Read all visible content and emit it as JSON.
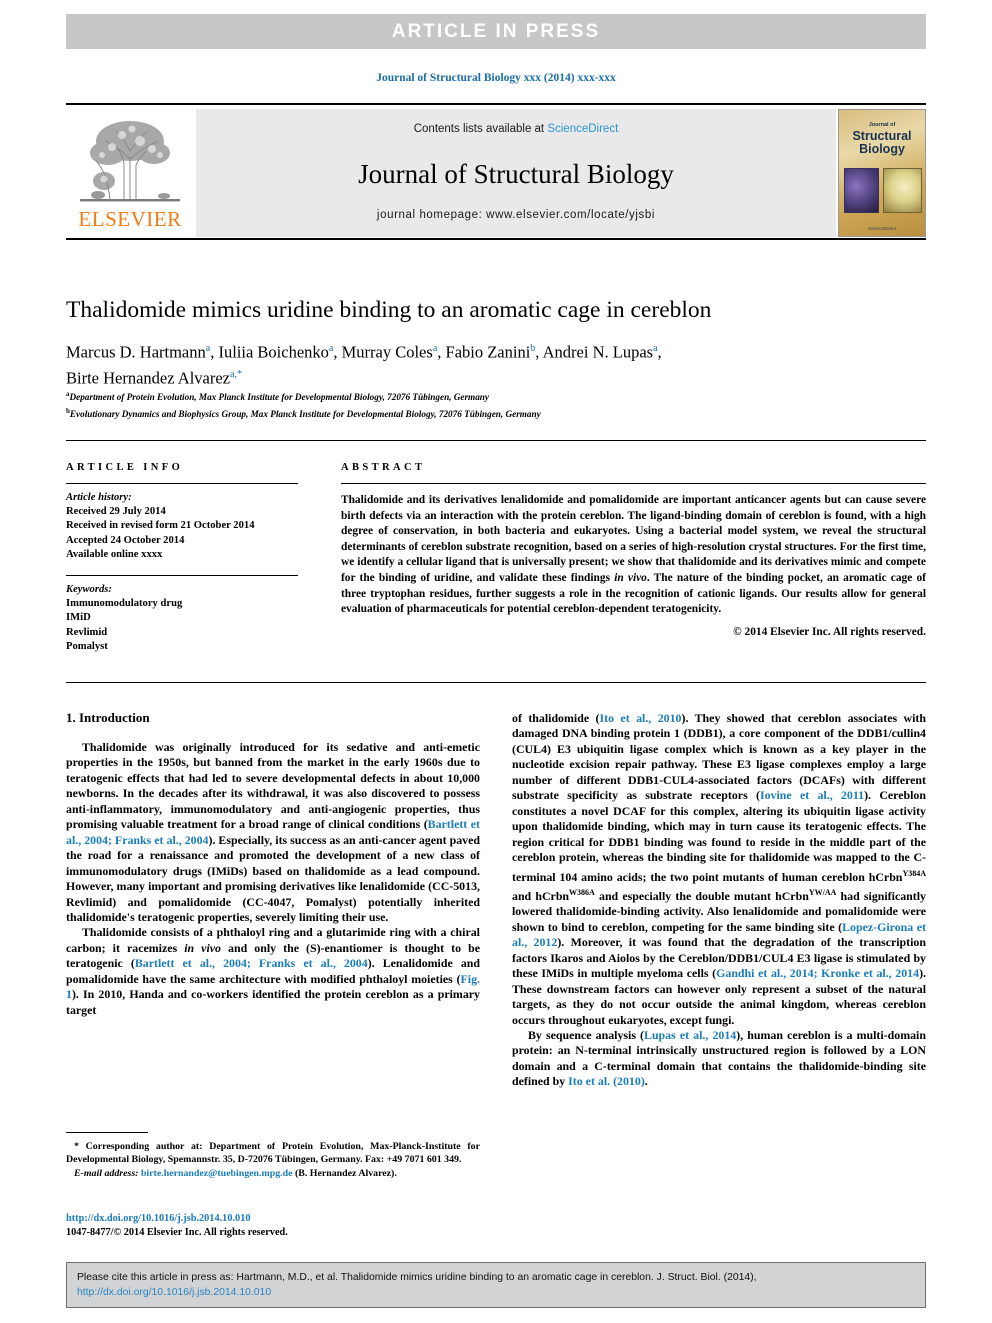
{
  "banner": {
    "text": "ARTICLE  IN  PRESS"
  },
  "journal_ref": "Journal of Structural Biology xxx (2014) xxx-xxx",
  "masthead": {
    "publisher": "ELSEVIER",
    "contents_prefix": "Contents lists available at ",
    "contents_link": "ScienceDirect",
    "journal_title": "Journal of Structural Biology",
    "homepage": "journal homepage: www.elsevier.com/locate/yjsbi",
    "cover": {
      "top_label": "Journal of",
      "line1": "Structural",
      "line2": "Biology",
      "bottom": "ScienceDirect"
    }
  },
  "article": {
    "title": "Thalidomide mimics uridine binding to an aromatic cage in cereblon",
    "authors_line1": "Marcus D. Hartmann a, Iuliia Boichenko a, Murray Coles a, Fabio Zanini b, Andrei N. Lupas a,",
    "authors_line2": "Birte Hernandez Alvarez a,*",
    "affiliation_a": "Department of Protein Evolution, Max Planck Institute for Developmental Biology, 72076 Tübingen, Germany",
    "affiliation_b": "Evolutionary Dynamics and Biophysics Group, Max Planck Institute for Developmental Biology, 72076 Tübingen, Germany"
  },
  "info": {
    "heading": "ARTICLE INFO",
    "history_label": "Article history:",
    "history": [
      "Received 29 July 2014",
      "Received in revised form 21 October 2014",
      "Accepted 24 October 2014",
      "Available online xxxx"
    ],
    "keywords_label": "Keywords:",
    "keywords": [
      "Immunomodulatory drug",
      "IMiD",
      "Revlimid",
      "Pomalyst"
    ]
  },
  "abstract": {
    "heading": "ABSTRACT",
    "text_1": "Thalidomide and its derivatives lenalidomide and pomalidomide are important anticancer agents but can cause severe birth defects via an interaction with the protein cereblon. The ligand-binding domain of cereblon is found, with a high degree of conservation, in both bacteria and eukaryotes. Using a bacterial model system, we reveal the structural determinants of cereblon substrate recognition, based on a series of high-resolution crystal structures. For the first time, we identify a cellular ligand that is universally present; we show that thalidomide and its derivatives mimic and compete for the binding of uridine, and validate these findings ",
    "italic_1": "in vivo",
    "text_2": ". The nature of the binding pocket, an aromatic cage of three tryptophan residues, further suggests a role in the recognition of cationic ligands. Our results allow for general evaluation of pharmaceuticals for potential cereblon-dependent teratogenicity.",
    "rights": "© 2014 Elsevier Inc. All rights reserved."
  },
  "body": {
    "section_heading": "1. Introduction",
    "left": {
      "p1_a": "Thalidomide was originally introduced for its sedative and anti-emetic properties in the 1950s, but banned from the market in the early 1960s due to teratogenic effects that had led to severe developmental defects in about 10,000 newborns. In the decades after its withdrawal, it was also discovered to possess anti-inflammatory, immunomodulatory and anti-angiogenic properties, thus promising valuable treatment for a broad range of clinical conditions (",
      "p1_cite1": "Bartlett et al., 2004; Franks et al., 2004",
      "p1_b": "). Especially, its success as an anti-cancer agent paved the road for a renaissance and promoted the development of a new class of immunomodulatory drugs (IMiDs) based on thalidomide as a lead compound. However, many important and promising derivatives like lenalidomide (CC-5013, Revlimid) and pomalidomide (CC-4047, Pomalyst) potentially inherited thalidomide's teratogenic properties, severely limiting their use.",
      "p2_a": "Thalidomide consists of a phthaloyl ring and a glutarimide ring with a chiral carbon; it racemizes ",
      "p2_it1": "in vivo",
      "p2_b": " and only the (S)-enantiomer is thought to be teratogenic (",
      "p2_cite1": "Bartlett et al., 2004; Franks et al., 2004",
      "p2_c": "). Lenalidomide and pomalidomide have the same architecture with modified phthaloyl moieties (",
      "p2_cite2": "Fig. 1",
      "p2_d": "). In 2010, Handa and co-workers identified the protein cereblon as a primary target"
    },
    "right": {
      "p1_a": "of thalidomide (",
      "p1_cite1": "Ito et al., 2010",
      "p1_b": "). They showed that cereblon associates with damaged DNA binding protein 1 (DDB1), a core component of the DDB1/cullin4 (CUL4) E3 ubiquitin ligase complex which is known as a key player in the nucleotide excision repair pathway. These E3 ligase complexes employ a large number of different DDB1-CUL4-associated factors (DCAFs) with different substrate specificity as substrate receptors (",
      "p1_cite2": "Iovine et al., 2011",
      "p1_c": "). Cereblon constitutes a novel DCAF for this complex, altering its ubiquitin ligase activity upon thalidomide binding, which may in turn cause its teratogenic effects. The region critical for DDB1 binding was found to reside in the middle part of the cereblon protein, whereas the binding site for thalidomide was mapped to the C-terminal 104 amino acids; the two point mutants of human cereblon hCrbn",
      "p1_sup1": "Y384A",
      "p1_d": " and hCrbn",
      "p1_sup2": "W386A",
      "p1_e": " and especially the double mutant hCrbn",
      "p1_sup3": "YW/AA",
      "p1_f": " had significantly lowered thalidomide-binding activity. Also lenalidomide and pomalidomide were shown to bind to cereblon, competing for the same binding site (",
      "p1_cite3": "Lopez-Girona et al., 2012",
      "p1_g": "). Moreover, it was found that the degradation of the transcription factors Ikaros and Aiolos by the Cereblon/DDB1/CUL4 E3 ligase is stimulated by these IMiDs in multiple myeloma cells (",
      "p1_cite4": "Gandhi et al., 2014; Kronke et al., 2014",
      "p1_h": "). These downstream factors can however only represent a subset of the natural targets, as they do not occur outside the animal kingdom, whereas cereblon occurs throughout eukaryotes, except fungi.",
      "p2_a": "By sequence analysis (",
      "p2_cite1": "Lupas et al., 2014",
      "p2_b": "), human cereblon is a multi-domain protein: an N-terminal intrinsically unstructured region is followed by a LON domain and a C-terminal domain that contains the thalidomide-binding site defined by ",
      "p2_cite2": "Ito et al. (2010)",
      "p2_c": "."
    }
  },
  "footnote": {
    "star_text": "* Corresponding author at: Department of Protein Evolution, Max-Planck-Institute for Developmental Biology, Spemannstr. 35, D-72076 Tübingen, Germany. Fax: +49 7071 601 349.",
    "email_label": "E-mail address:",
    "email": "birte.hernandez@tuebingen.mpg.de",
    "email_owner": "(B. Hernandez Alvarez)."
  },
  "doi_block": {
    "doi_url": "http://dx.doi.org/10.1016/j.jsb.2014.10.010",
    "issn_line": "1047-8477/© 2014 Elsevier Inc. All rights reserved."
  },
  "cite_box": {
    "prefix": "Please cite this article in press as: Hartmann, M.D., et al. Thalidomide mimics uridine binding to an aromatic cage in cereblon. J. Struct. Biol. (2014), ",
    "link": "http://dx.doi.org/10.1016/j.jsb.2014.10.010"
  },
  "colors": {
    "banner_grey": "#c6c7c9",
    "link_blue": "#1a7cb8",
    "sciencedirect_blue": "#2a94d6",
    "elsevier_orange": "#f07c16",
    "panel_grey": "#e9e9e9",
    "cite_grey": "#d2d3d5"
  }
}
